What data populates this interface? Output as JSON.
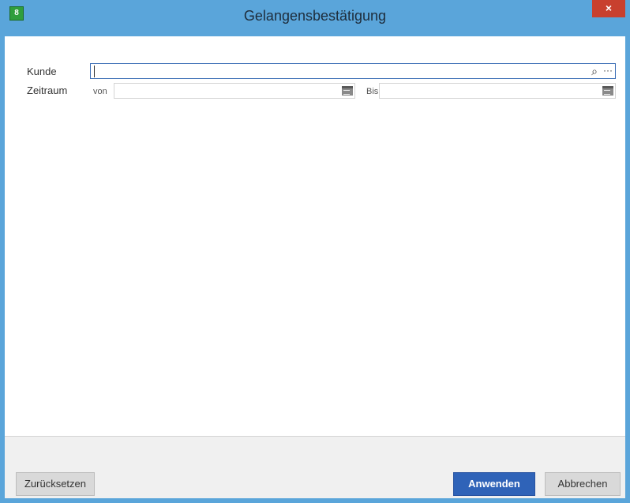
{
  "window": {
    "title": "Gelangensbestätigung",
    "close_label": "×",
    "app_icon_label": "8"
  },
  "form": {
    "kunde_label": "Kunde",
    "kunde_value": "",
    "zeitraum_label": "Zeitraum",
    "von_label": "von",
    "von_value": "",
    "bis_label": "Bis",
    "bis_value": ""
  },
  "icons": {
    "search": "⌕",
    "more": "···"
  },
  "buttons": {
    "reset_label": "Zurücksetzen",
    "apply_label": "Anwenden",
    "cancel_label": "Abbrechen"
  },
  "colors": {
    "titlebar": "#5aa5da",
    "primary_button": "#2f63b8",
    "close_button": "#c8402e"
  }
}
